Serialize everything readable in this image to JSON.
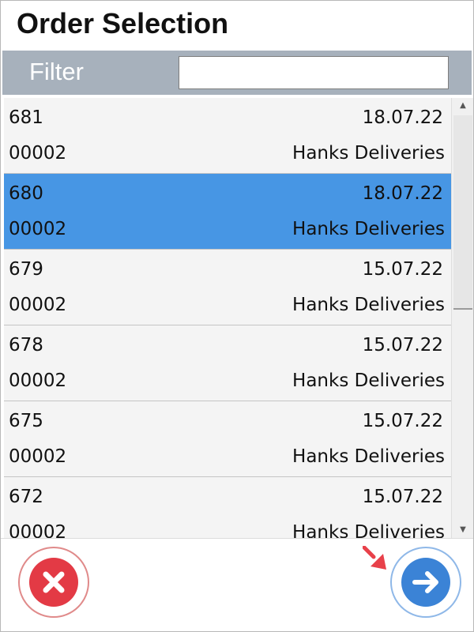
{
  "window": {
    "title": "Order Selection"
  },
  "filter": {
    "label": "Filter",
    "value": ""
  },
  "orders": [
    {
      "number": "681",
      "date": "18.07.22",
      "code": "00002",
      "customer": "Hanks Deliveries",
      "selected": false
    },
    {
      "number": "680",
      "date": "18.07.22",
      "code": "00002",
      "customer": "Hanks Deliveries",
      "selected": true
    },
    {
      "number": "679",
      "date": "15.07.22",
      "code": "00002",
      "customer": "Hanks Deliveries",
      "selected": false
    },
    {
      "number": "678",
      "date": "15.07.22",
      "code": "00002",
      "customer": "Hanks Deliveries",
      "selected": false
    },
    {
      "number": "675",
      "date": "15.07.22",
      "code": "00002",
      "customer": "Hanks Deliveries",
      "selected": false
    },
    {
      "number": "672",
      "date": "15.07.22",
      "code": "00002",
      "customer": "Hanks Deliveries",
      "selected": false
    }
  ],
  "icons": {
    "cancel": "close-icon",
    "next": "arrow-right-icon",
    "pointer": "pointer-arrow-icon",
    "scroll_up": "triangle-up-icon",
    "scroll_down": "triangle-down-icon"
  },
  "colors": {
    "selected_row": "#4796e4",
    "filter_bar": "#a7b1bc",
    "cancel": "#e33a45",
    "next": "#3b83d6",
    "pointer": "#e8414a"
  }
}
